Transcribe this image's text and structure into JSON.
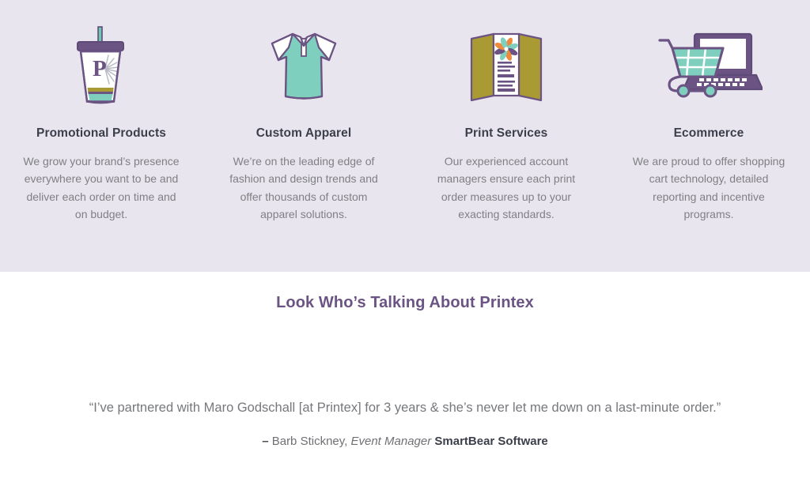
{
  "services": {
    "background_color": "#e9e5ee",
    "items": [
      {
        "icon": "tumbler-cup-icon",
        "title": "Promotional Products",
        "description": "We grow your brand’s presence everywhere you want to be and deliver each order on time and on budget."
      },
      {
        "icon": "polo-shirt-icon",
        "title": "Custom Apparel",
        "description": "We’re on the leading edge of fashion and design trends and offer thousands of custom apparel solutions."
      },
      {
        "icon": "brochure-icon",
        "title": "Print Services",
        "description": "Our experienced account managers ensure each print order measures up to your exacting standards."
      },
      {
        "icon": "shopping-cart-laptop-icon",
        "title": "Ecommerce",
        "description": "We are proud to offer shopping cart technology, detailed reporting and incentive programs."
      }
    ]
  },
  "testimonials": {
    "heading": "Look Who’s Talking About Printex",
    "heading_color": "#6b5383",
    "quote": "“I’ve partnered with Maro Godschall [at Printex] for 3 years & she’s never let me down on a last-minute order.”",
    "attribution": {
      "dash": "– ",
      "name": "Barb Stickney,",
      "role": " Event Manager ",
      "organization": "SmartBear Software"
    }
  },
  "palette": {
    "lavender_bg": "#e9e5ee",
    "purple": "#6b5383",
    "teal": "#7ecfbd",
    "olive": "#a99a33",
    "orange": "#ef8a3c",
    "heading_dark": "#3b3f4a",
    "body_gray": "#7f8084"
  }
}
